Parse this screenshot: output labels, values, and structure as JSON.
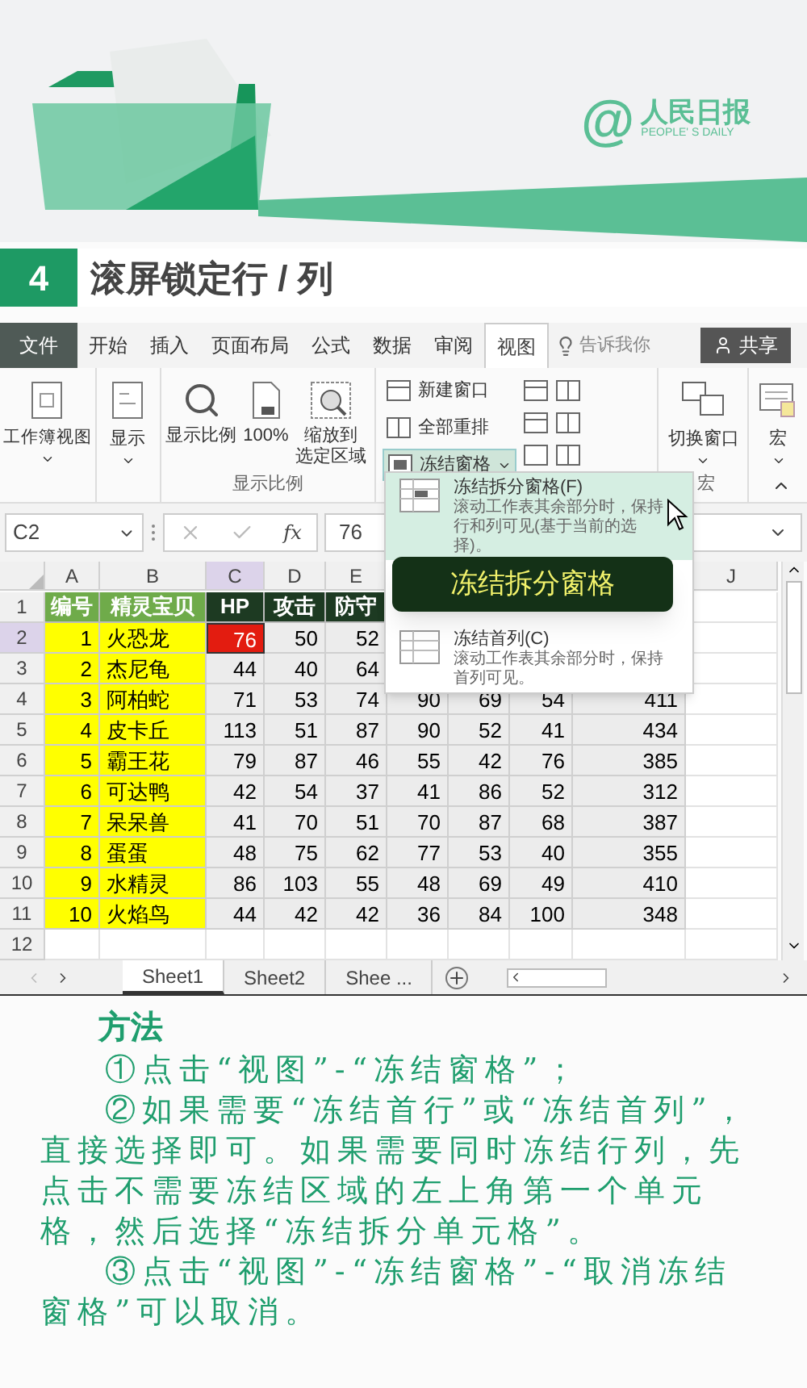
{
  "banner": {
    "logo_mark": "@",
    "logo_text": "人民日报",
    "logo_subtext": "PEOPLE' S DAILY"
  },
  "section": {
    "number": "4",
    "title": "滚屏锁定行 / 列"
  },
  "ribbon": {
    "tabs": [
      {
        "label": "文件",
        "kind": "file",
        "selected": false
      },
      {
        "label": "开始",
        "kind": "tab",
        "selected": false
      },
      {
        "label": "插入",
        "kind": "tab",
        "selected": false
      },
      {
        "label": "页面布局",
        "kind": "tab",
        "selected": false
      },
      {
        "label": "公式",
        "kind": "tab",
        "selected": false
      },
      {
        "label": "数据",
        "kind": "tab",
        "selected": false
      },
      {
        "label": "审阅",
        "kind": "tab",
        "selected": false
      },
      {
        "label": "视图",
        "kind": "tab",
        "selected": true
      }
    ],
    "tell_me": "告诉我你",
    "share": "共享",
    "workbook_views": "工作簿视图",
    "show": "显示",
    "zoom_group": {
      "label": "显示比例",
      "buttons": [
        {
          "lines": [
            "显示比例"
          ]
        },
        {
          "lines": [
            "100%"
          ]
        },
        {
          "lines": [
            "缩放到",
            "选定区域"
          ]
        }
      ]
    },
    "window_buttons": [
      {
        "label": "新建窗口",
        "selected": false
      },
      {
        "label": "全部重排",
        "selected": false
      },
      {
        "label": "冻结窗格",
        "selected": true
      }
    ],
    "switch_window": "切换窗口",
    "macro": {
      "button": "宏",
      "label": "宏"
    }
  },
  "formula_bar": {
    "name_box": "C2",
    "fx": "fx",
    "value": "76"
  },
  "grid": {
    "column_headers": [
      {
        "label": "A",
        "selected": false
      },
      {
        "label": "B",
        "selected": false
      },
      {
        "label": "C",
        "selected": true
      },
      {
        "label": "D",
        "selected": false
      },
      {
        "label": "E",
        "selected": false
      },
      {
        "label": "J",
        "selected": false
      }
    ],
    "rows": [
      {
        "number": "1",
        "kind": "header",
        "selected": false,
        "labels": [
          "编号",
          "精灵宝贝",
          "HP",
          "攻击",
          "防守"
        ]
      },
      {
        "number": "2",
        "kind": "data",
        "selected": true,
        "id": "1",
        "name": "火恐龙",
        "values": [
          "76",
          "50",
          "52"
        ]
      },
      {
        "number": "3",
        "kind": "data",
        "selected": false,
        "id": "2",
        "name": "杰尼龟",
        "values": [
          "44",
          "40",
          "64"
        ]
      },
      {
        "number": "4",
        "kind": "data",
        "selected": false,
        "id": "3",
        "name": "阿柏蛇",
        "values": [
          "71",
          "53",
          "74",
          "90",
          "69",
          "54",
          "411"
        ]
      },
      {
        "number": "5",
        "kind": "data",
        "selected": false,
        "id": "4",
        "name": "皮卡丘",
        "values": [
          "113",
          "51",
          "87",
          "90",
          "52",
          "41",
          "434"
        ]
      },
      {
        "number": "6",
        "kind": "data",
        "selected": false,
        "id": "5",
        "name": "霸王花",
        "values": [
          "79",
          "87",
          "46",
          "55",
          "42",
          "76",
          "385"
        ]
      },
      {
        "number": "7",
        "kind": "data",
        "selected": false,
        "id": "6",
        "name": "可达鸭",
        "values": [
          "42",
          "54",
          "37",
          "41",
          "86",
          "52",
          "312"
        ]
      },
      {
        "number": "8",
        "kind": "data",
        "selected": false,
        "id": "7",
        "name": "呆呆兽",
        "values": [
          "41",
          "70",
          "51",
          "70",
          "87",
          "68",
          "387"
        ]
      },
      {
        "number": "9",
        "kind": "data",
        "selected": false,
        "id": "8",
        "name": "蛋蛋",
        "values": [
          "48",
          "75",
          "62",
          "77",
          "53",
          "40",
          "355"
        ]
      },
      {
        "number": "10",
        "kind": "data",
        "selected": false,
        "id": "9",
        "name": "水精灵",
        "values": [
          "86",
          "103",
          "55",
          "48",
          "69",
          "49",
          "410"
        ]
      },
      {
        "number": "11",
        "kind": "data",
        "selected": false,
        "id": "10",
        "name": "火焰鸟",
        "values": [
          "44",
          "42",
          "42",
          "36",
          "84",
          "100",
          "348"
        ]
      },
      {
        "number": "12",
        "kind": "empty",
        "selected": false
      }
    ]
  },
  "freeze_menu": {
    "items": [
      {
        "title": "冻结拆分窗格(F)",
        "description": "滚动工作表其余部分时，保持行和列可见(基于当前的选择)。",
        "selected": true
      },
      {
        "title": "冻结首列(C)",
        "description": "滚动工作表其余部分时，保持首列可见。",
        "selected": false
      }
    ],
    "callout": "冻结拆分窗格"
  },
  "sheet_tabs": [
    {
      "label": "Sheet1",
      "selected": true
    },
    {
      "label": "Sheet2",
      "selected": false
    },
    {
      "label": "Shee ...",
      "selected": false
    }
  ],
  "method": {
    "title": "方法",
    "paragraphs": [
      "①点击“视图”-“冻结窗格”；",
      "②如果需要“冻结首行”或“冻结首列”，直接选择即可。如果需要同时冻结行列，先点击不需要冻结区域的左上角第一个单元格，然后选择“冻结拆分单元格”。",
      "③点击“视图”-“冻结窗格”-“取消冻结窗格”可以取消。"
    ]
  }
}
